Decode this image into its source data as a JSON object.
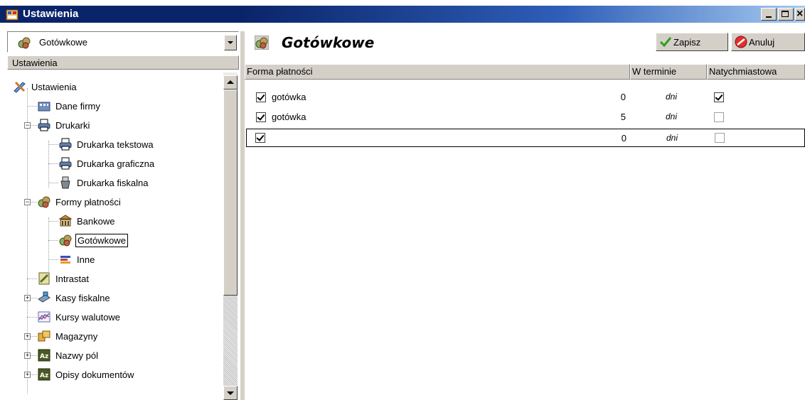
{
  "window": {
    "title": "Ustawienia"
  },
  "left": {
    "combo_value": "Gotówkowe",
    "section_header": "Ustawienia",
    "tree": [
      {
        "label": "Ustawienia",
        "icon": "tools-icon"
      },
      {
        "label": "Dane firmy",
        "icon": "company-icon"
      },
      {
        "label": "Drukarki",
        "icon": "printer-icon"
      },
      {
        "label": "Drukarka tekstowa",
        "icon": "printer-icon"
      },
      {
        "label": "Drukarka graficzna",
        "icon": "printer-icon"
      },
      {
        "label": "Drukarka fiskalna",
        "icon": "fiscal-printer-icon"
      },
      {
        "label": "Formy płatności",
        "icon": "coins-icon"
      },
      {
        "label": "Bankowe",
        "icon": "bank-icon"
      },
      {
        "label": "Gotówkowe",
        "icon": "coins-icon"
      },
      {
        "label": "Inne",
        "icon": "flag-icon"
      },
      {
        "label": "Intrastat",
        "icon": "note-icon"
      },
      {
        "label": "Kasy fiskalne",
        "icon": "cash-register-icon"
      },
      {
        "label": "Kursy walutowe",
        "icon": "chart-icon"
      },
      {
        "label": "Magazyny",
        "icon": "warehouse-icon"
      },
      {
        "label": "Nazwy pól",
        "icon": "az-icon"
      },
      {
        "label": "Opisy dokumentów",
        "icon": "az-icon"
      }
    ]
  },
  "right": {
    "title": "Gotówkowe",
    "save_label": "Zapisz",
    "cancel_label": "Anuluj",
    "columns": [
      "Forma płatności",
      "W terminie",
      "Natychmiastowa"
    ],
    "rows": [
      {
        "checked": true,
        "name": "gotówka",
        "days": "0",
        "unit": "dni",
        "immediate": true
      },
      {
        "checked": true,
        "name": "gotówka",
        "days": "5",
        "unit": "dni",
        "immediate": false
      },
      {
        "checked": true,
        "name": "",
        "days": "0",
        "unit": "dni",
        "immediate": false
      }
    ]
  },
  "colors": {
    "titlebar": "#0a246a",
    "face": "#d4d0c8"
  }
}
